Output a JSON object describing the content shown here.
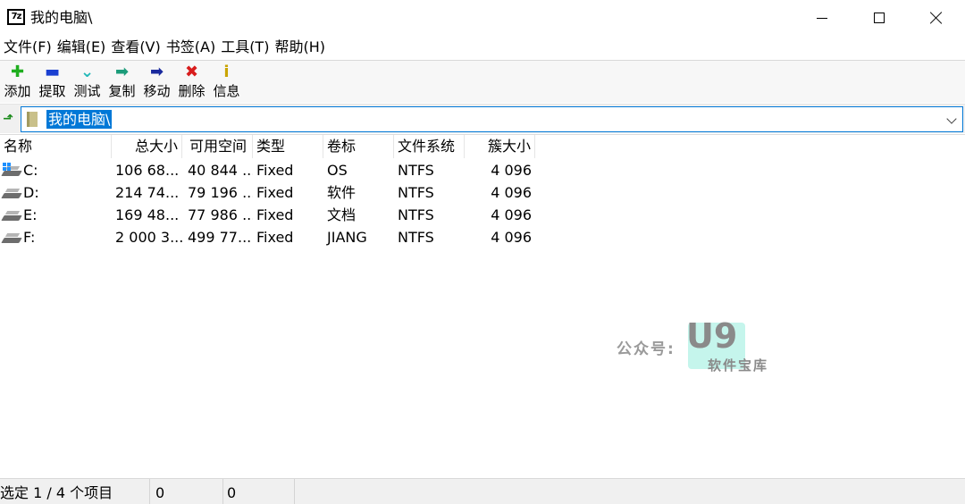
{
  "window": {
    "app_icon_text": "7z",
    "title": "我的电脑\\"
  },
  "menu": [
    "文件(F)",
    "编辑(E)",
    "查看(V)",
    "书签(A)",
    "工具(T)",
    "帮助(H)"
  ],
  "toolbar": [
    {
      "label": "添加",
      "icon": "add-icon",
      "glyph": "✚",
      "color": "#1fae1f"
    },
    {
      "label": "提取",
      "icon": "extract-icon",
      "glyph": "▬",
      "color": "#1a3fd1"
    },
    {
      "label": "测试",
      "icon": "test-icon",
      "glyph": "⌄",
      "color": "#1fb7b7"
    },
    {
      "label": "复制",
      "icon": "copy-icon",
      "glyph": "➡",
      "color": "#1c9c7a"
    },
    {
      "label": "移动",
      "icon": "move-icon",
      "glyph": "➡",
      "color": "#1a2a9e"
    },
    {
      "label": "删除",
      "icon": "delete-icon",
      "glyph": "✖",
      "color": "#d81c1c"
    },
    {
      "label": "信息",
      "icon": "info-icon",
      "glyph": "i",
      "color": "#c9a400"
    }
  ],
  "address": {
    "path": "我的电脑\\"
  },
  "columns": {
    "name": "名称",
    "total_size": "总大小",
    "free_space": "可用空间",
    "type": "类型",
    "label": "卷标",
    "filesystem": "文件系统",
    "cluster": "簇大小"
  },
  "drives": [
    {
      "name": "C:",
      "total": "106 68...",
      "free": "40 844 ...",
      "type": "Fixed",
      "label": "OS",
      "fs": "NTFS",
      "cluster": "4 096"
    },
    {
      "name": "D:",
      "total": "214 74...",
      "free": "79 196 ...",
      "type": "Fixed",
      "label": "软件",
      "fs": "NTFS",
      "cluster": "4 096"
    },
    {
      "name": "E:",
      "total": "169 48...",
      "free": "77 986 ...",
      "type": "Fixed",
      "label": "文档",
      "fs": "NTFS",
      "cluster": "4 096"
    },
    {
      "name": "F:",
      "total": "2 000 3...",
      "free": "499 77...",
      "type": "Fixed",
      "label": "JIANG",
      "fs": "NTFS",
      "cluster": "4 096"
    }
  ],
  "watermark": {
    "prefix": "公众号:",
    "brand": "U9",
    "sub": "软件宝库"
  },
  "status": {
    "selection": "选定 1 / 4 个项目",
    "size": "0",
    "packed": "0"
  }
}
